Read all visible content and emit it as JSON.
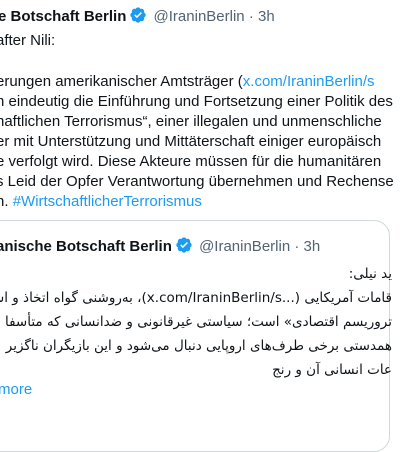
{
  "tweet": {
    "account_name": "e Botschaft Berlin",
    "handle": "@IraninBerlin",
    "separator": "·",
    "time": "3h",
    "intro": "after Nili:",
    "lines": [
      {
        "pre": "erungen amerikanischer Amtsträger (",
        "link": "x.com/IraninBerlin/s",
        "post": ""
      },
      {
        "pre": "n eindeutig die Einführung und Fortsetzung einer Politik des",
        "link": "",
        "post": ""
      },
      {
        "pre": "haftlichen Terrorismus“, einer illegalen und unmenschliche",
        "link": "",
        "post": ""
      },
      {
        "pre": "er mit Unterstützung und Mittäterschaft einiger europäisch",
        "link": "",
        "post": ""
      },
      {
        "pre": "e verfolgt wird. Diese Akteure müssen für die humanitären",
        "link": "",
        "post": ""
      },
      {
        "pre": "s Leid der Opfer Verantwortung übernehmen und Rechense",
        "link": "",
        "post": ""
      },
      {
        "pre": "n. ",
        "link": "#WirtschaftlicherTerrorismus",
        "post": ""
      }
    ]
  },
  "quoted": {
    "account_name": "anische Botschaft Berlin",
    "handle": "@IraninBerlin",
    "separator": "·",
    "time": "3h",
    "rtl_lines": [
      "ید نیلی:",
      "قامات آمریکایی (...x.com/IraninBerlin/s)، به‌روشنی گواه اتخاذ و اس",
      "تروریسم اقتصادی» است؛ سیاستی غیرقانونی و ضدانسانی که متأسفا",
      "همدستی برخی طرف‌های اروپایی دنبال می‌شود و این بازیگران ناگزیر",
      "عات انسانی آن و رنج"
    ],
    "show_more": "more"
  },
  "colors": {
    "link": "#1d9bf0",
    "verified": "#1d9bf0",
    "muted": "#536471",
    "border": "#cfd9de"
  }
}
